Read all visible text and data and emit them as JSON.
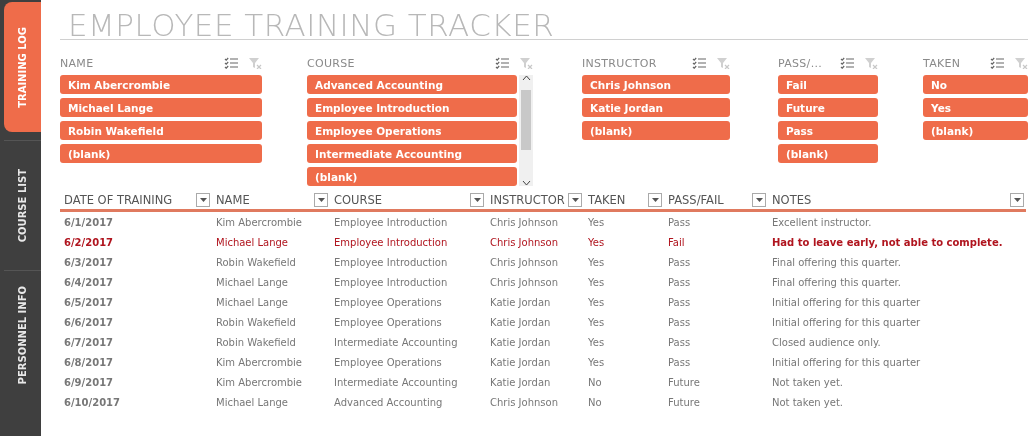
{
  "sidebar": {
    "tabs": [
      {
        "label": "TRAINING LOG",
        "selected": true
      },
      {
        "label": "COURSE LIST",
        "selected": false
      },
      {
        "label": "PERSONNEL INFO",
        "selected": false
      }
    ]
  },
  "title": "EMPLOYEE TRAINING TRACKER",
  "slicers": [
    {
      "title": "NAME",
      "scrollbar": false,
      "items": [
        "Kim Abercrombie",
        "Michael Lange",
        "Robin Wakefield",
        "(blank)"
      ]
    },
    {
      "title": "COURSE",
      "scrollbar": true,
      "items": [
        "Advanced Accounting",
        "Employee Introduction",
        "Employee Operations",
        "Intermediate Accounting",
        "(blank)"
      ]
    },
    {
      "title": "INSTRUCTOR",
      "scrollbar": false,
      "items": [
        "Chris Johnson",
        "Katie Jordan",
        "(blank)"
      ]
    },
    {
      "title": "PASS/...",
      "scrollbar": false,
      "items": [
        "Fail",
        "Future",
        "Pass",
        "(blank)"
      ]
    },
    {
      "title": "TAKEN",
      "scrollbar": false,
      "items": [
        "No",
        "Yes",
        "(blank)"
      ]
    }
  ],
  "table": {
    "columns": [
      "DATE OF TRAINING",
      "NAME",
      "COURSE",
      "INSTRUCTOR",
      "TAKEN",
      "PASS/FAIL",
      "NOTES"
    ],
    "rows": [
      {
        "highlighted": false,
        "cells": [
          "6/1/2017",
          "Kim Abercrombie",
          "Employee Introduction",
          "Chris Johnson",
          "Yes",
          "Pass",
          "Excellent instructor."
        ]
      },
      {
        "highlighted": true,
        "cells": [
          "6/2/2017",
          "Michael Lange",
          "Employee Introduction",
          "Chris Johnson",
          "Yes",
          "Fail",
          "Had to leave early, not able to complete."
        ]
      },
      {
        "highlighted": false,
        "cells": [
          "6/3/2017",
          "Robin Wakefield",
          "Employee Introduction",
          "Chris Johnson",
          "Yes",
          "Pass",
          "Final offering this quarter."
        ]
      },
      {
        "highlighted": false,
        "cells": [
          "6/4/2017",
          "Michael Lange",
          "Employee Introduction",
          "Chris Johnson",
          "Yes",
          "Pass",
          "Final offering this quarter."
        ]
      },
      {
        "highlighted": false,
        "cells": [
          "6/5/2017",
          "Michael Lange",
          "Employee Operations",
          "Katie Jordan",
          "Yes",
          "Pass",
          "Initial offering for this quarter"
        ]
      },
      {
        "highlighted": false,
        "cells": [
          "6/6/2017",
          "Robin Wakefield",
          "Employee Operations",
          "Katie Jordan",
          "Yes",
          "Pass",
          "Initial offering for this quarter"
        ]
      },
      {
        "highlighted": false,
        "cells": [
          "6/7/2017",
          "Robin Wakefield",
          "Intermediate Accounting",
          "Katie Jordan",
          "Yes",
          "Pass",
          "Closed audience only."
        ]
      },
      {
        "highlighted": false,
        "cells": [
          "6/8/2017",
          "Kim Abercrombie",
          "Employee Operations",
          "Katie Jordan",
          "Yes",
          "Pass",
          "Initial offering for this quarter"
        ]
      },
      {
        "highlighted": false,
        "cells": [
          "6/9/2017",
          "Kim Abercrombie",
          "Intermediate Accounting",
          "Katie Jordan",
          "No",
          "Future",
          "Not taken yet."
        ]
      },
      {
        "highlighted": false,
        "cells": [
          "6/10/2017",
          "Michael Lange",
          "Advanced Accounting",
          "Chris Johnson",
          "No",
          "Future",
          "Not taken yet."
        ]
      }
    ]
  }
}
